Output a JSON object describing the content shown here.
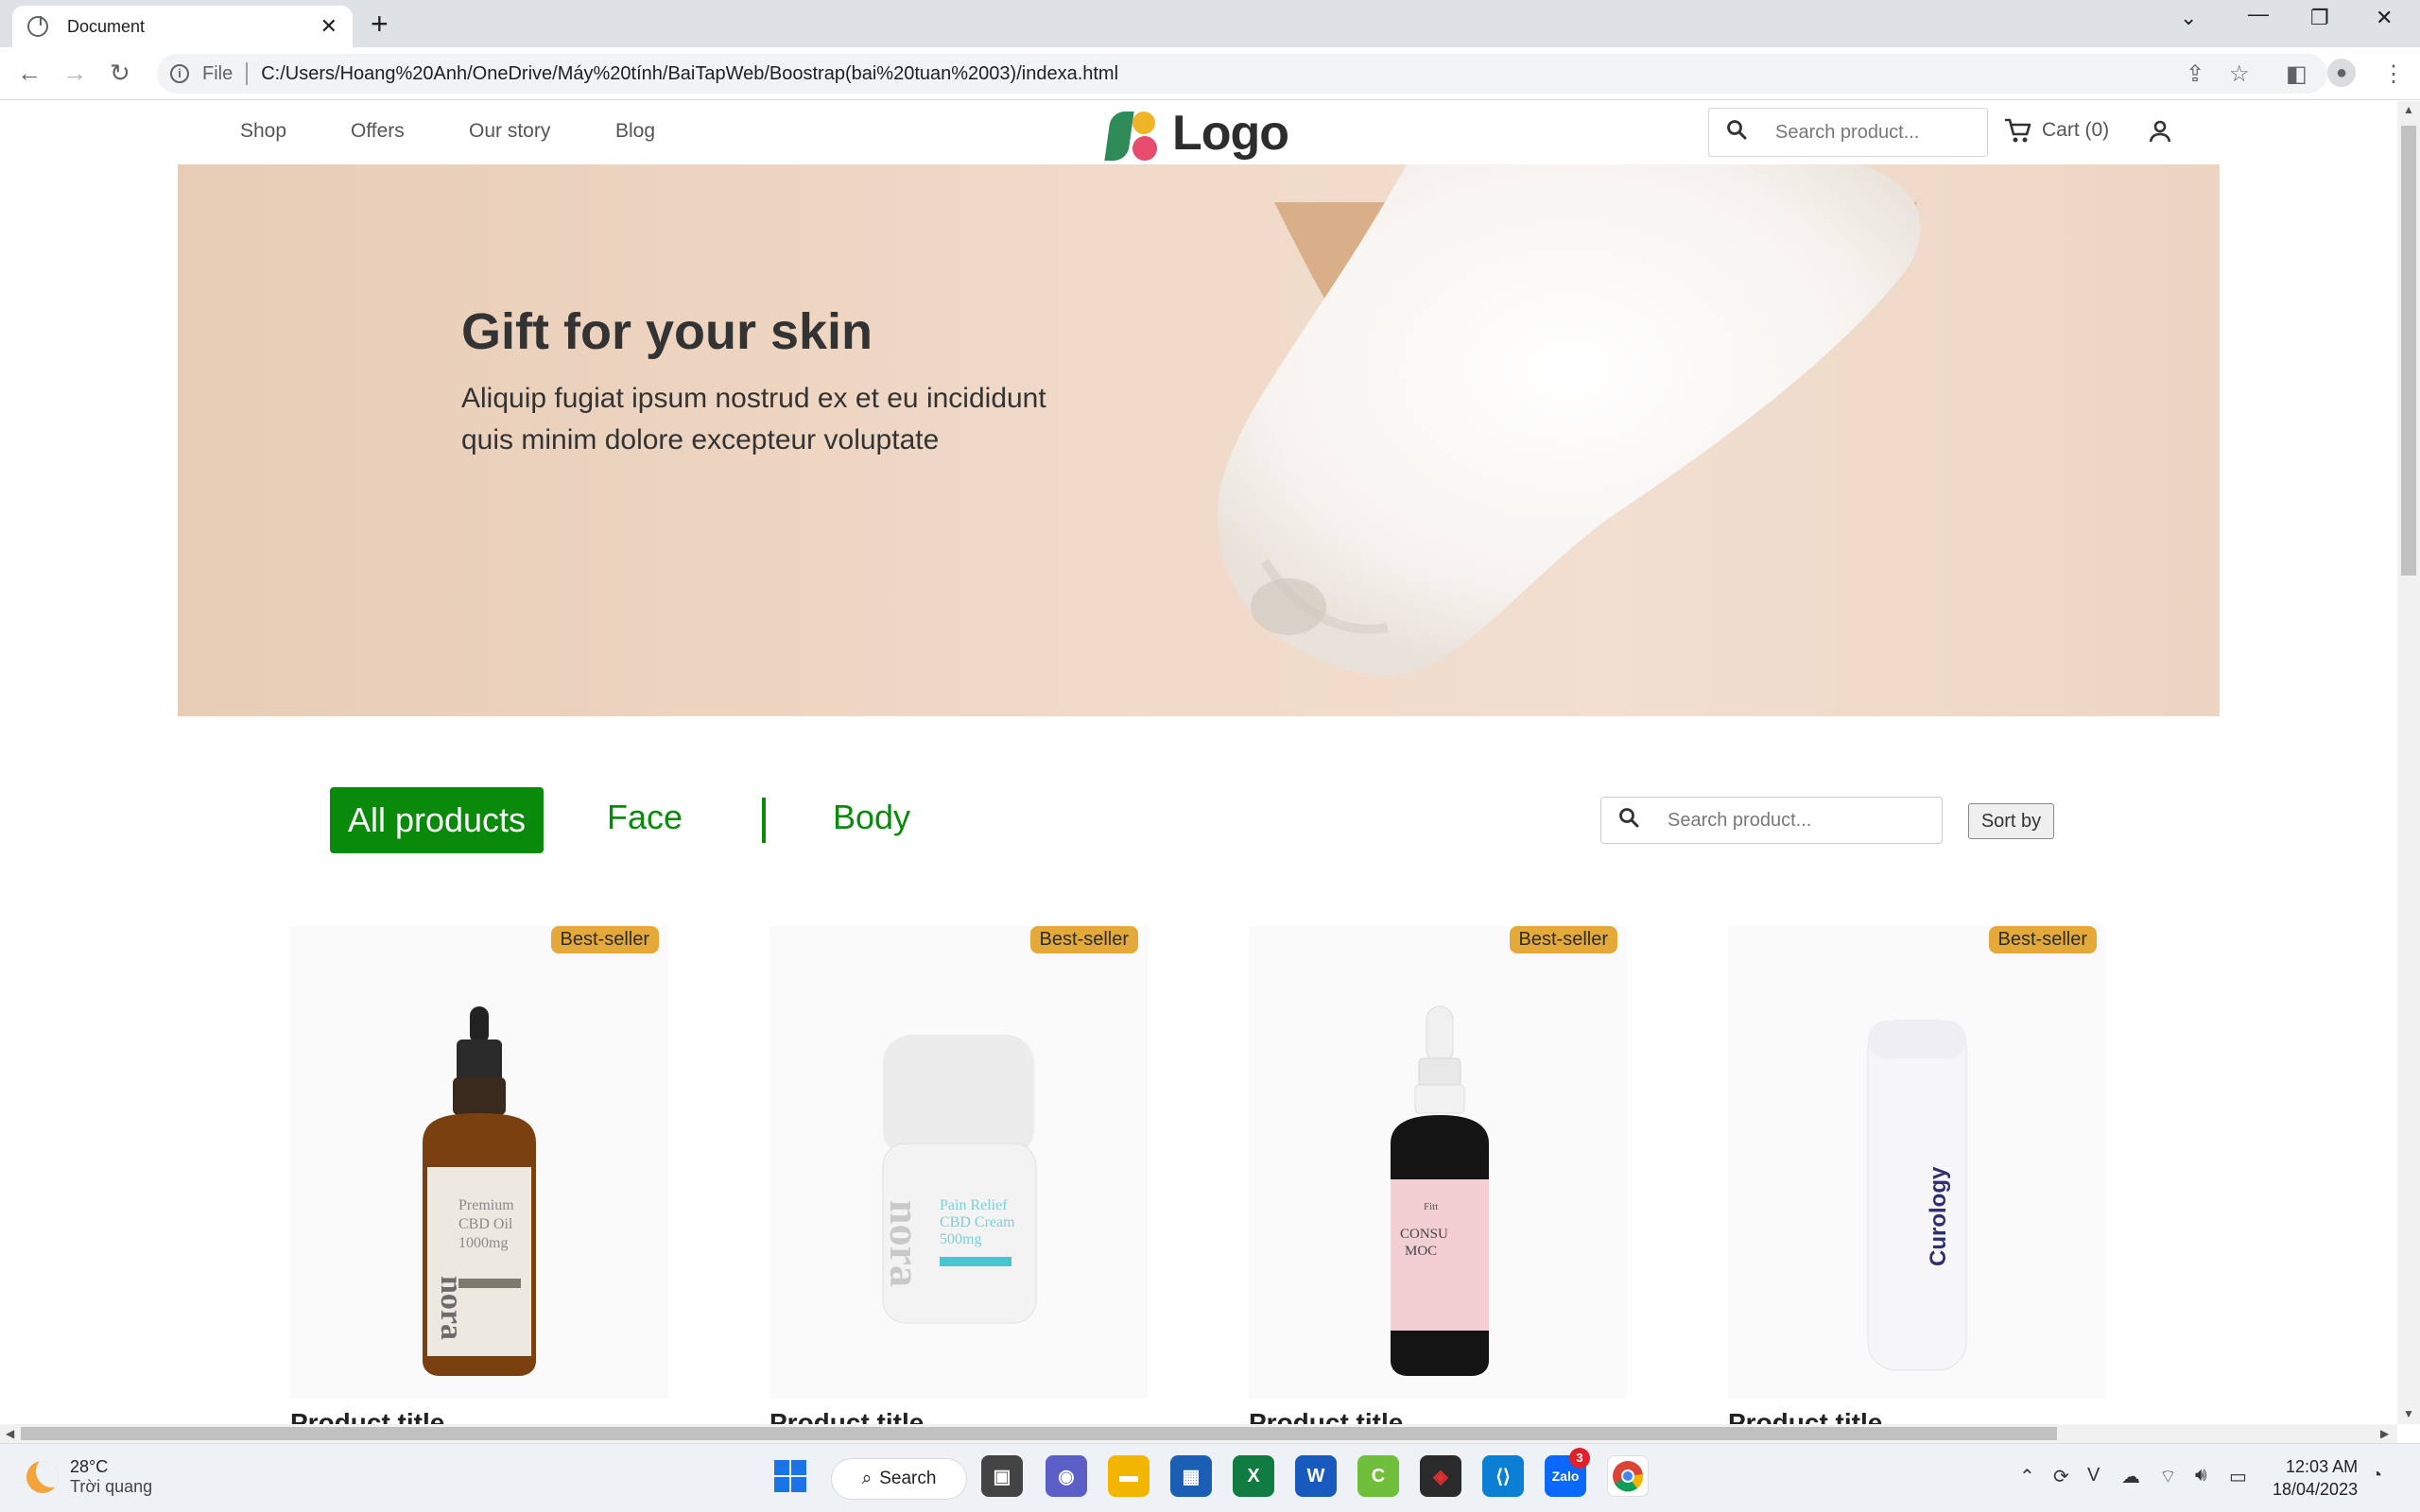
{
  "browser": {
    "tab_title": "Document",
    "tab_close": "✕",
    "new_tab": "+",
    "scheme": "File",
    "url": "C:/Users/Hoang%20Anh/OneDrive/Máy%20tính/BaiTapWeb/Boostrap(bai%20tuan%2003)/indexa.html"
  },
  "site": {
    "nav": [
      "Shop",
      "Offers",
      "Our story",
      "Blog"
    ],
    "logo_text": "Logo",
    "header_search_placeholder": "Search product...",
    "cart_label": "Cart (0)",
    "hero": {
      "title": "Gift for your skin",
      "text": "Aliquip fugiat ipsum nostrud ex et eu incididunt quis minim dolore excepteur voluptate"
    },
    "filters": {
      "active": "All products",
      "face": "Face",
      "body": "Body"
    },
    "product_search_placeholder": "Search product...",
    "sort_label": "Sort by",
    "products": [
      {
        "badge": "Best-seller",
        "title": "Product title",
        "bottle": "dropper-amber",
        "label": "Premium CBD Oil 1000mg"
      },
      {
        "badge": "Best-seller",
        "title": "Product title",
        "bottle": "jar-white",
        "label": "Pain Relief CBD Cream 500mg"
      },
      {
        "badge": "Best-seller",
        "title": "Product title",
        "bottle": "dropper-black-pink",
        "label": "CONSU MOC"
      },
      {
        "badge": "Best-seller",
        "title": "Product title",
        "bottle": "pump-white",
        "label": "Curology"
      }
    ]
  },
  "taskbar": {
    "weather_temp": "28°C",
    "weather_desc": "Trời quang",
    "search_label": "Search",
    "zalo_badge": "3",
    "time": "12:03 AM",
    "date": "18/04/2023"
  },
  "colors": {
    "accent_green": "#0a8a0a",
    "badge": "#e5a93a"
  }
}
